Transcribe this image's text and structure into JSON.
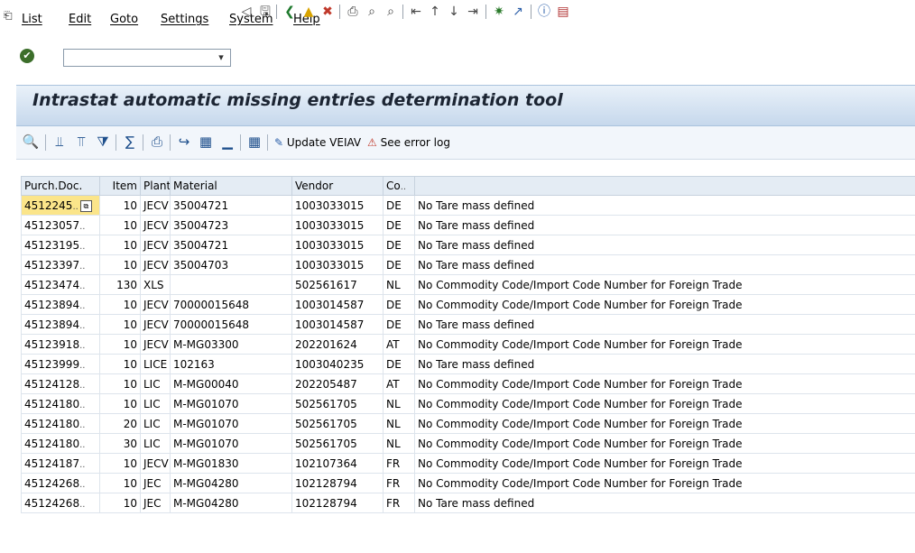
{
  "menu": {
    "items": [
      "List",
      "Edit",
      "Goto",
      "Settings",
      "System",
      "Help"
    ]
  },
  "toolbar": {
    "command_field_value": ""
  },
  "page": {
    "title": "Intrastat automatic missing entries determination tool"
  },
  "app_toolbar": {
    "update_label": "Update VEIAV",
    "error_log_label": "See error log"
  },
  "grid": {
    "columns": [
      "Purch.Doc.",
      "Item",
      "Plant",
      "Material",
      "Vendor",
      "Co",
      ""
    ],
    "rows": [
      {
        "doc": "4512245",
        "item": "10",
        "plant": "JECV",
        "material": "35004721",
        "vendor": "1003033015",
        "co": "DE",
        "message": "No Tare mass defined"
      },
      {
        "doc": "45123057",
        "item": "10",
        "plant": "JECV",
        "material": "35004723",
        "vendor": "1003033015",
        "co": "DE",
        "message": "No Tare mass defined"
      },
      {
        "doc": "45123195",
        "item": "10",
        "plant": "JECV",
        "material": "35004721",
        "vendor": "1003033015",
        "co": "DE",
        "message": "No Tare mass defined"
      },
      {
        "doc": "45123397",
        "item": "10",
        "plant": "JECV",
        "material": "35004703",
        "vendor": "1003033015",
        "co": "DE",
        "message": "No Tare mass defined"
      },
      {
        "doc": "45123474",
        "item": "130",
        "plant": "XLS",
        "material": "",
        "vendor": "502561617",
        "co": "NL",
        "message": "No Commodity Code/Import Code Number for Foreign Trade"
      },
      {
        "doc": "45123894",
        "item": "10",
        "plant": "JECV",
        "material": "70000015648",
        "vendor": "1003014587",
        "co": "DE",
        "message": "No Commodity Code/Import Code Number for Foreign Trade"
      },
      {
        "doc": "45123894",
        "item": "10",
        "plant": "JECV",
        "material": "70000015648",
        "vendor": "1003014587",
        "co": "DE",
        "message": "No Tare mass defined"
      },
      {
        "doc": "45123918",
        "item": "10",
        "plant": "JECV",
        "material": "M-MG03300",
        "vendor": "202201624",
        "co": "AT",
        "message": "No Commodity Code/Import Code Number for Foreign Trade"
      },
      {
        "doc": "45123999",
        "item": "10",
        "plant": "LICE",
        "material": "102163",
        "vendor": "1003040235",
        "co": "DE",
        "message": "No Tare mass defined"
      },
      {
        "doc": "45124128",
        "item": "10",
        "plant": "LIC",
        "material": "M-MG00040",
        "vendor": "202205487",
        "co": "AT",
        "message": "No Commodity Code/Import Code Number for Foreign Trade"
      },
      {
        "doc": "45124180",
        "item": "10",
        "plant": "LIC",
        "material": "M-MG01070",
        "vendor": "502561705",
        "co": "NL",
        "message": "No Commodity Code/Import Code Number for Foreign Trade"
      },
      {
        "doc": "45124180",
        "item": "20",
        "plant": "LIC",
        "material": "M-MG01070",
        "vendor": "502561705",
        "co": "NL",
        "message": "No Commodity Code/Import Code Number for Foreign Trade"
      },
      {
        "doc": "45124180",
        "item": "30",
        "plant": "LIC",
        "material": "M-MG01070",
        "vendor": "502561705",
        "co": "NL",
        "message": "No Commodity Code/Import Code Number for Foreign Trade"
      },
      {
        "doc": "45124187",
        "item": "10",
        "plant": "JECV",
        "material": "M-MG01830",
        "vendor": "102107364",
        "co": "FR",
        "message": "No Commodity Code/Import Code Number for Foreign Trade"
      },
      {
        "doc": "45124268",
        "item": "10",
        "plant": "JEC",
        "material": "M-MG04280",
        "vendor": "102128794",
        "co": "FR",
        "message": "No Commodity Code/Import Code Number for Foreign Trade"
      },
      {
        "doc": "45124268",
        "item": "10",
        "plant": "JEC",
        "material": "M-MG04280",
        "vendor": "102128794",
        "co": "FR",
        "message": "No Tare mass defined"
      }
    ]
  }
}
